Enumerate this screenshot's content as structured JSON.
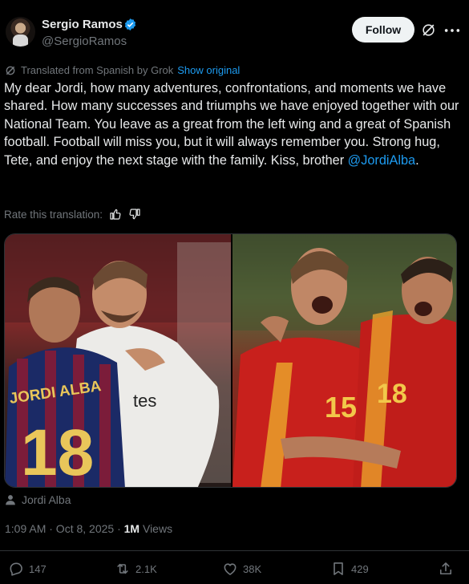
{
  "author": {
    "name": "Sergio Ramos",
    "handle": "@SergioRamos",
    "verified_color": "#1d9bf0",
    "follow_label": "Follow"
  },
  "translation": {
    "notice": "Translated from Spanish by Grok",
    "show_original": "Show original",
    "rate_label": "Rate this translation:"
  },
  "tweet": {
    "text": "My dear Jordi, how many adventures, confrontations, and moments we have shared. How many successes and triumphs we have enjoyed together with our National Team. You leave as a great from the left wing and a great of Spanish football. Football will miss you, but it will always remember you. Strong hug, Tete, and enjoy the next stage with the family. Kiss, brother ",
    "mention": "@JordiAlba",
    "end": "."
  },
  "media": {
    "tagged_user": "Jordi Alba",
    "left_photo": {
      "jersey_name": "JORDI ALBA",
      "jersey_number": "18",
      "sponsor": "tes"
    },
    "right_photo": {
      "number_left": "15",
      "number_right": "18"
    }
  },
  "meta": {
    "time": "1:09 AM · Oct 8, 2025 · ",
    "views_count": "1M",
    "views_label": " Views"
  },
  "actions": {
    "replies": "147",
    "reposts": "2.1K",
    "likes": "38K",
    "bookmarks": "429"
  },
  "colors": {
    "background": "#000000",
    "text": "#e7e9ea",
    "muted": "#71767b",
    "accent": "#1d9bf0"
  }
}
